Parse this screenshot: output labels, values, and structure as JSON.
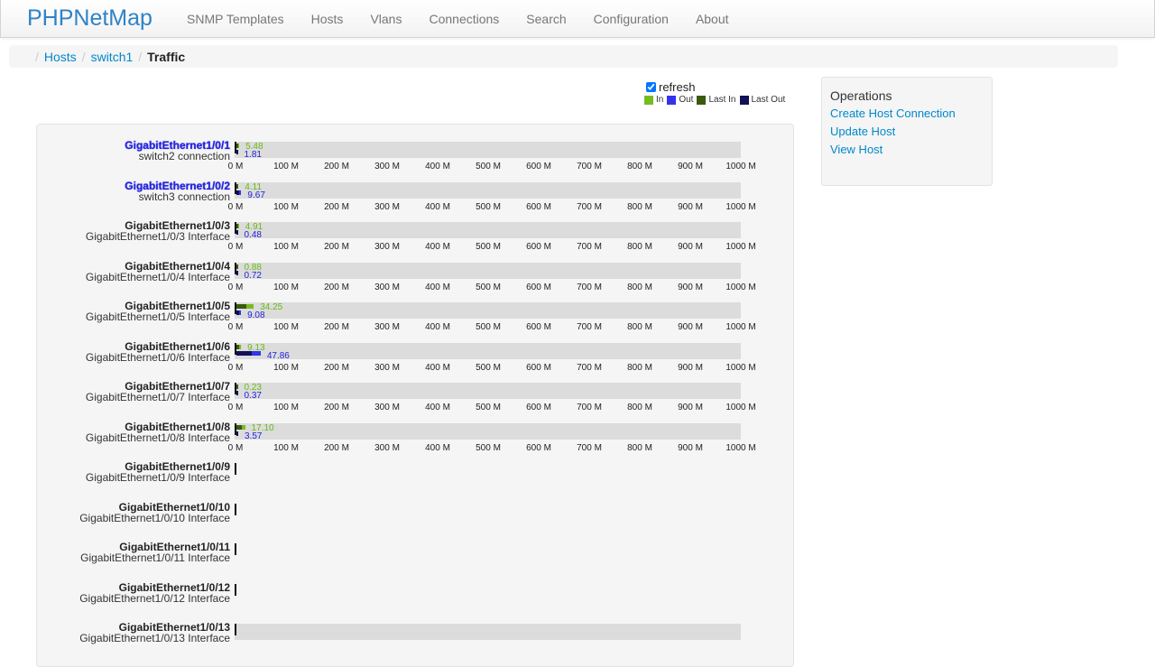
{
  "brand": "PHPNetMap",
  "nav": [
    "SNMP Templates",
    "Hosts",
    "Vlans",
    "Connections",
    "Search",
    "Configuration",
    "About"
  ],
  "breadcrumb": {
    "items": [
      "Hosts",
      "switch1"
    ],
    "active": "Traffic"
  },
  "refresh": {
    "label": "refresh",
    "checked": true
  },
  "legend": [
    {
      "label": "In",
      "color": "#77bb22"
    },
    {
      "label": "Out",
      "color": "#3333ee"
    },
    {
      "label": "Last In",
      "color": "#3a5a10"
    },
    {
      "label": "Last Out",
      "color": "#111155"
    }
  ],
  "operations": {
    "title": "Operations",
    "links": [
      "Create Host Connection",
      "Update Host",
      "View Host"
    ]
  },
  "axis": {
    "ticks": [
      "0 M",
      "100 M",
      "200 M",
      "300 M",
      "400 M",
      "500 M",
      "600 M",
      "700 M",
      "800 M",
      "900 M",
      "1000 M"
    ],
    "max": 1000
  },
  "interfaces": [
    {
      "name": "GigabitEthernet1/0/1",
      "desc": "switch2 connection",
      "link": true,
      "in": "5.48",
      "out": "1.81",
      "in_v": 5.48,
      "out_v": 1.81,
      "last_in_v": 3.0,
      "last_out_v": 1.0,
      "graph": true
    },
    {
      "name": "GigabitEthernet1/0/2",
      "desc": "switch3 connection",
      "link": true,
      "in": "4.11",
      "out": "9.67",
      "in_v": 4.11,
      "out_v": 9.67,
      "last_in_v": 2.5,
      "last_out_v": 5.0,
      "graph": true
    },
    {
      "name": "GigabitEthernet1/0/3",
      "desc": "GigabitEthernet1/0/3 Interface",
      "link": false,
      "in": "4.91",
      "out": "0.48",
      "in_v": 4.91,
      "out_v": 0.48,
      "last_in_v": 2.5,
      "last_out_v": 0.3,
      "graph": true
    },
    {
      "name": "GigabitEthernet1/0/4",
      "desc": "GigabitEthernet1/0/4 Interface",
      "link": false,
      "in": "0.88",
      "out": "0.72",
      "in_v": 0.88,
      "out_v": 0.72,
      "last_in_v": 0.5,
      "last_out_v": 0.4,
      "graph": true
    },
    {
      "name": "GigabitEthernet1/0/5",
      "desc": "GigabitEthernet1/0/5 Interface",
      "link": false,
      "in": "34.25",
      "out": "9.08",
      "in_v": 34.25,
      "out_v": 9.08,
      "last_in_v": 20.0,
      "last_out_v": 5.0,
      "graph": true
    },
    {
      "name": "GigabitEthernet1/0/6",
      "desc": "GigabitEthernet1/0/6 Interface",
      "link": false,
      "in": "9.13",
      "out": "47.86",
      "in_v": 9.13,
      "out_v": 47.86,
      "last_in_v": 5.0,
      "last_out_v": 30.0,
      "graph": true
    },
    {
      "name": "GigabitEthernet1/0/7",
      "desc": "GigabitEthernet1/0/7 Interface",
      "link": false,
      "in": "0.23",
      "out": "0.37",
      "in_v": 0.23,
      "out_v": 0.37,
      "last_in_v": 0.1,
      "last_out_v": 0.2,
      "graph": true
    },
    {
      "name": "GigabitEthernet1/0/8",
      "desc": "GigabitEthernet1/0/8 Interface",
      "link": false,
      "in": "17.10",
      "out": "3.57",
      "in_v": 17.1,
      "out_v": 3.57,
      "last_in_v": 10.0,
      "last_out_v": 2.0,
      "graph": true
    },
    {
      "name": "GigabitEthernet1/0/9",
      "desc": "GigabitEthernet1/0/9 Interface",
      "link": false,
      "graph": false
    },
    {
      "name": "GigabitEthernet1/0/10",
      "desc": "GigabitEthernet1/0/10 Interface",
      "link": false,
      "graph": false
    },
    {
      "name": "GigabitEthernet1/0/11",
      "desc": "GigabitEthernet1/0/11 Interface",
      "link": false,
      "graph": false
    },
    {
      "name": "GigabitEthernet1/0/12",
      "desc": "GigabitEthernet1/0/12 Interface",
      "link": false,
      "graph": false
    },
    {
      "name": "GigabitEthernet1/0/13",
      "desc": "GigabitEthernet1/0/13 Interface",
      "link": false,
      "graph": true,
      "partial": true
    }
  ]
}
